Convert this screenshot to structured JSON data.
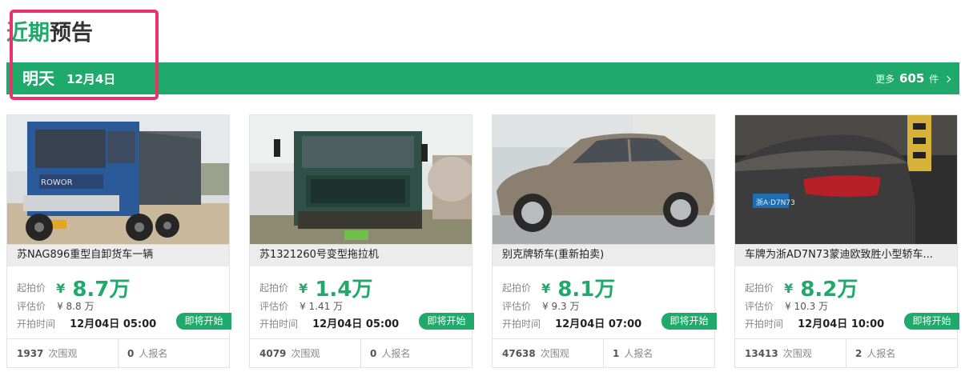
{
  "section": {
    "heading_highlight": "近期",
    "heading_rest": "预告"
  },
  "day_bar": {
    "day": "明天",
    "date": "12月4日",
    "more_prefix": "更多",
    "more_count": "605",
    "more_suffix": "件"
  },
  "labels": {
    "start_price": "起拍价",
    "estimate": "评估价",
    "start_time": "开拍时间",
    "views_suffix": "次围观",
    "signups_suffix": "人报名"
  },
  "items": [
    {
      "title": "苏NAG896重型自卸货车一辆",
      "yen": "¥",
      "start_price": "8.7万",
      "estimate": "¥ 8.8 万",
      "start_time": "12月04日 05:00",
      "status": "即将开始",
      "views": "1937",
      "signups": "0",
      "photo_icon": "dump-truck-photo"
    },
    {
      "title": "苏1321260号变型拖拉机",
      "yen": "¥",
      "start_price": "1.4万",
      "estimate": "¥ 1.41 万",
      "start_time": "12月04日 05:00",
      "status": "即将开始",
      "views": "4079",
      "signups": "0",
      "photo_icon": "tractor-photo"
    },
    {
      "title": "别克牌轿车(重新拍卖)",
      "yen": "¥",
      "start_price": "8.1万",
      "estimate": "¥ 9.3 万",
      "start_time": "12月04日 07:00",
      "status": "即将开始",
      "views": "47638",
      "signups": "1",
      "photo_icon": "sedan-photo"
    },
    {
      "title": "车牌为浙AD7N73蒙迪欧致胜小型轿车...",
      "yen": "¥",
      "start_price": "8.2万",
      "estimate": "¥ 10.3 万",
      "start_time": "12月04日 10:00",
      "status": "即将开始",
      "views": "13413",
      "signups": "2",
      "photo_icon": "dark-sedan-photo",
      "plate_text": "浙A·D7N73"
    }
  ],
  "colors": {
    "accent": "#1fa96a",
    "highlight_border": "#e8336a"
  }
}
